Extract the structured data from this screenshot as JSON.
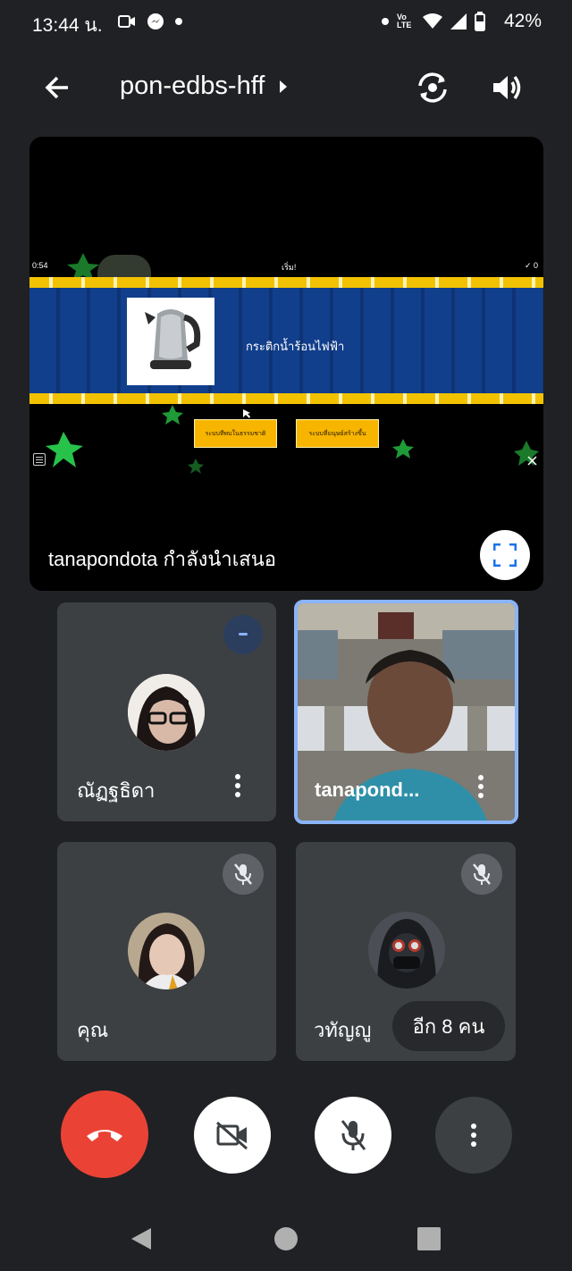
{
  "status": {
    "time": "13:44 น.",
    "icons": [
      "camera-icon",
      "messenger-icon",
      "dot-icon",
      "dot-icon",
      "volte-icon",
      "wifi-icon",
      "signal-icon",
      "battery-icon"
    ],
    "volte": "Vo LTE",
    "battery": "42%"
  },
  "header": {
    "meeting_code": "pon-edbs-hff"
  },
  "presentation": {
    "timer": "0:54",
    "start_label": "เริ่ม!",
    "score": "✓ 0",
    "question": "กระติกน้ำร้อนไฟฟ้า",
    "choice1": "ระบบทีพบในธรรมชาติ",
    "choice2": "ระบบที่มนุษย์สร้างขึ้น",
    "presenter_label": "tanapondota กำลังนำเสนอ"
  },
  "participants": [
    {
      "name": "ณัฏฐธิดา"
    },
    {
      "name": "tanapond..."
    },
    {
      "name": "คุณ"
    },
    {
      "name": "วทัญญู"
    }
  ],
  "more_people": "อีก 8 คน",
  "colors": {
    "background": "#202124",
    "tile": "#3c4043",
    "end_call": "#ea4335",
    "active_border": "#8ab4f8",
    "accent_blue": "#1a73e8"
  }
}
